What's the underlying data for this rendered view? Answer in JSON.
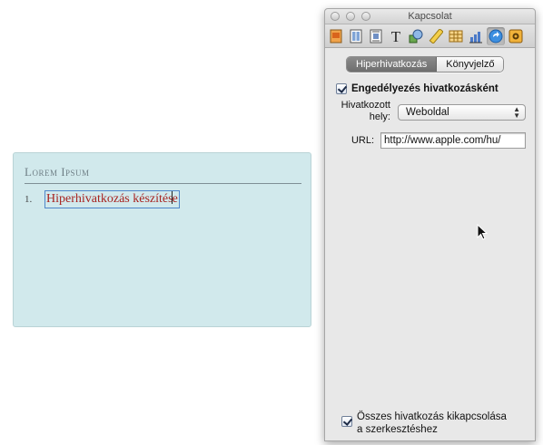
{
  "document": {
    "heading": "Lorem Ipsum",
    "list_number": "1.",
    "link_text": "Hiperhivatkozás készítés",
    "link_text_tail": "e"
  },
  "inspector": {
    "title": "Kapcsolat",
    "toolbar_icons": [
      "document-inspector-icon",
      "layout-inspector-icon",
      "wrap-inspector-icon",
      "text-inspector-icon",
      "graphic-inspector-icon",
      "metrics-inspector-icon",
      "table-inspector-icon",
      "chart-inspector-icon",
      "link-inspector-icon",
      "quicktime-inspector-icon"
    ],
    "active_toolbar_icon": "link-inspector-icon",
    "tabs": [
      {
        "label": "Hiperhivatkozás",
        "selected": true
      },
      {
        "label": "Könyvjelző",
        "selected": false
      }
    ],
    "enable_link": {
      "label": "Engedélyezés hivatkozásként",
      "checked": true
    },
    "link_to_label_line1": "Hivatkozott",
    "link_to_label_line2": "hely:",
    "link_to_value": "Weboldal",
    "url_label": "URL:",
    "url_value": "http://www.apple.com/hu/",
    "disable_all": {
      "label_line1": "Összes hivatkozás kikapcsolása",
      "label_line2": "a szerkesztéshez",
      "checked": true
    }
  },
  "colors": {
    "doc_background": "#d1e9ec",
    "link_color": "#a8231f",
    "selection_border": "#4f86c9",
    "panel_background": "#e8e8e8"
  }
}
